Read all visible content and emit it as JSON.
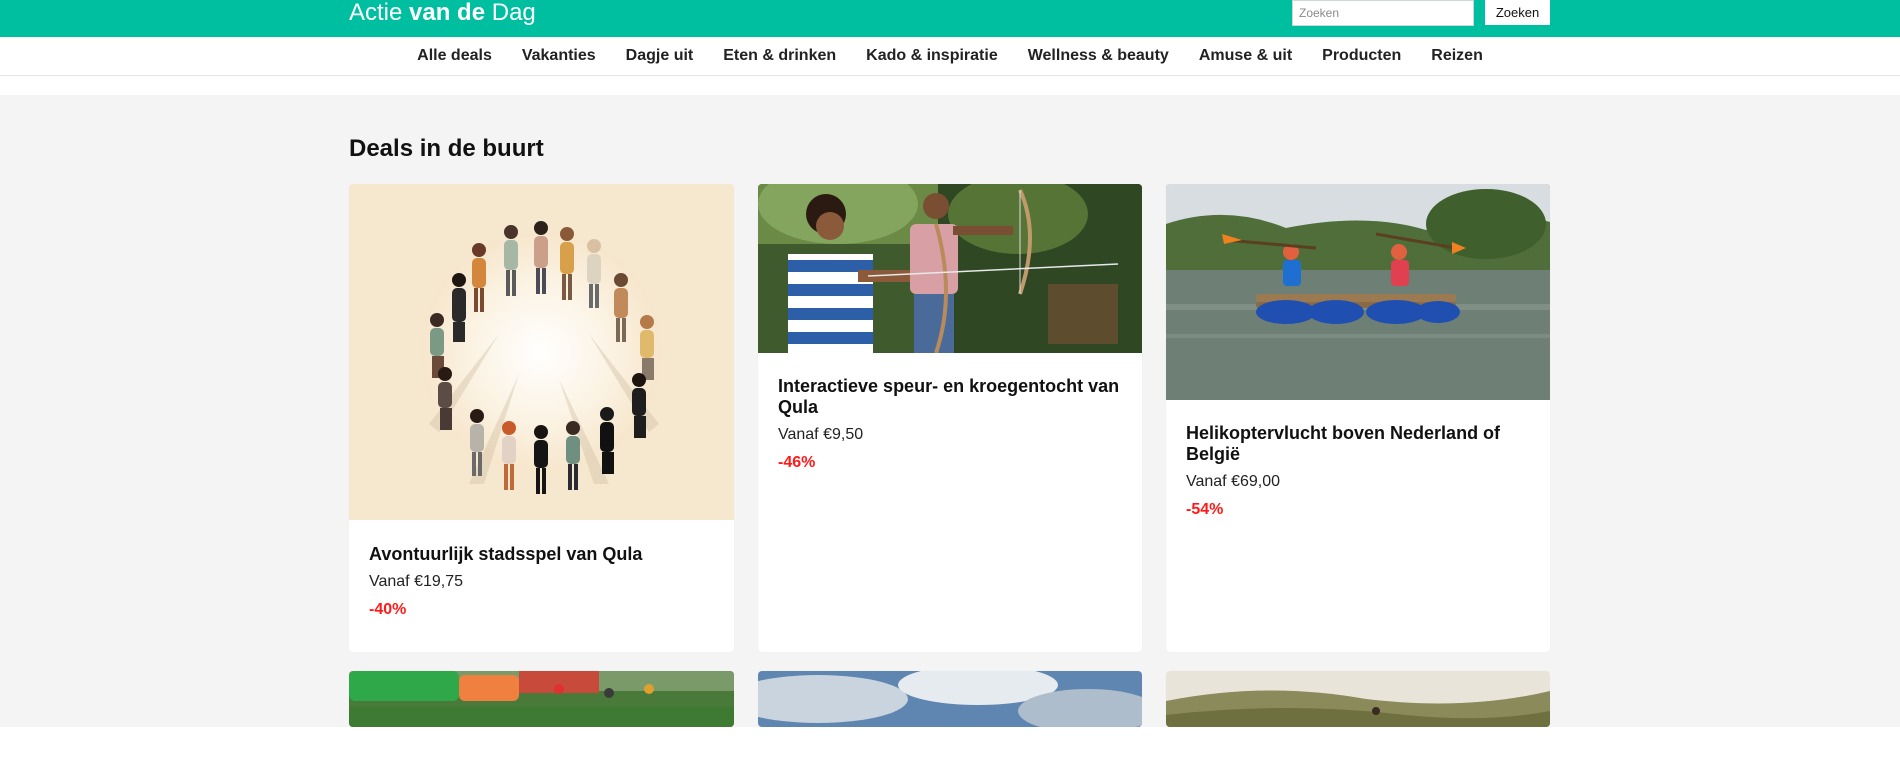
{
  "header": {
    "brand_prefix": "Actie ",
    "brand_bold": "van de",
    "brand_suffix": " Dag",
    "search_placeholder": "Zoeken",
    "search_button": "Zoeken",
    "colors": {
      "accent": "#00bfa0",
      "discount": "#ff1a1a"
    }
  },
  "nav": {
    "items": [
      {
        "label": "Alle deals"
      },
      {
        "label": "Vakanties"
      },
      {
        "label": "Dagje uit"
      },
      {
        "label": "Eten & drinken"
      },
      {
        "label": "Kado & inspiratie"
      },
      {
        "label": "Wellness & beauty"
      },
      {
        "label": "Amuse & uit"
      },
      {
        "label": "Producten"
      },
      {
        "label": "Reizen"
      }
    ]
  },
  "main": {
    "section_title": "Deals in de buurt",
    "deals": [
      {
        "title": "Avontuurlijk stadsspel van Qula",
        "price": "Vanaf €19,75",
        "discount": "-40%",
        "image": "illustration-people-circle"
      },
      {
        "title": "Interactieve speur- en kroegentocht van Qula",
        "price": "Vanaf €9,50",
        "discount": "-46%",
        "image": "photo-archery"
      },
      {
        "title": "Helikoptervlucht boven Nederland of België",
        "price": "Vanaf €69,00",
        "discount": "-54%",
        "image": "photo-raft-lake"
      }
    ],
    "next_row_images": [
      "photo-playground",
      "photo-cloudy-sky",
      "photo-dunes"
    ]
  }
}
